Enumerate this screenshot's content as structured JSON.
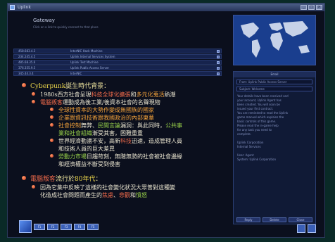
{
  "window": {
    "title": "Uplink"
  },
  "gateway": {
    "title": "Gateway",
    "subtitle": "Click on a link to quickly connect to that place",
    "rows": [
      {
        "ip": "458.683.4.3",
        "name": "InterNIC Hack Machine"
      },
      {
        "ip": "234.245.4.5",
        "name": "Uplink Internal Services System"
      },
      {
        "ip": "485.68.35.6",
        "name": "Uplink Test Machine"
      },
      {
        "ip": "376.355.9.5",
        "name": "Uplink Public Access Server"
      },
      {
        "ip": "345.44.3.4",
        "name": "InterNIC"
      }
    ]
  },
  "slide": {
    "l1_a": {
      "prefix": "Cyberpunk",
      "text": "誕生時代背景："
    },
    "l2_a": {
      "text": "1980s西方社會呈現",
      "h1": "科技全球化擴張",
      "t2": "和",
      "h2": "多元化蒐活",
      "t3": "熱潮"
    },
    "l2_b": {
      "h1": "電腦叛客",
      "text": "運動成為後工業/後資本社會的名聲現物"
    },
    "l3_a": {
      "text": "全球性資本的大勢作變成無國族的國家"
    },
    "l3_b": {
      "text": "企業跟資訊技術跟我國政治的內部東華"
    },
    "l3_c": {
      "h1": "社會控制",
      "text": "舞弊、",
      "h2": "民間言論",
      "t2": "漏洞：與此同時，",
      "h3": "公共事"
    },
    "l3_c2": {
      "text": "業和",
      "h1": "社會組織",
      "t2": "漸受其害，困難重重"
    },
    "l3_d": {
      "text": "世界經濟動盪不安，高新",
      "h1": "科技",
      "t2": "迅速，造成管理人員"
    },
    "l3_d2": {
      "text": "和技術人員的巨大差異"
    },
    "l3_e": {
      "h1": "勞動力市場",
      "text": "日趨苛刻，無階無勢的社會被社會邊緣"
    },
    "l3_e2": {
      "text": "和經濟權益不斷受到侵害"
    },
    "l1_b": {
      "h1": "電腦叛客",
      "text": "流行於",
      "h2": "80年代",
      "t2": "："
    },
    "l2_c": {
      "text": "因為它集中反映了這樣的社會變化狀況大眾普對這種變"
    },
    "l2_c2": {
      "text": "化造成社會問題而產生的",
      "h1": "焦慮",
      "t2": "、",
      "h2": "悲觀",
      "t3": "和",
      "h3": "憤怒"
    }
  },
  "right_panel": {
    "header": "Email",
    "from": "From: Uplink Public Access Server",
    "subject": "Subject: Welcome",
    "body": "Your details have been received and\nyour account, Uplink Agent has\nbeen created. You will soon be\nissued your first contract.\nYou are reminded to read the Uplink\ngame manual which explains the\nbasic controls of this game.\nPlease read the in-game help\nfor any task you need to\ncomplete.\n\nUplink Corporation\nInternal Services\n\nUser: Agent\nSystem: Uplink Corporation",
    "buttons": [
      "Reply",
      "Delete",
      "Close"
    ]
  },
  "taskbar": {
    "buttons": [
      "F1",
      "F2",
      "F3",
      "F4",
      "F5"
    ]
  }
}
